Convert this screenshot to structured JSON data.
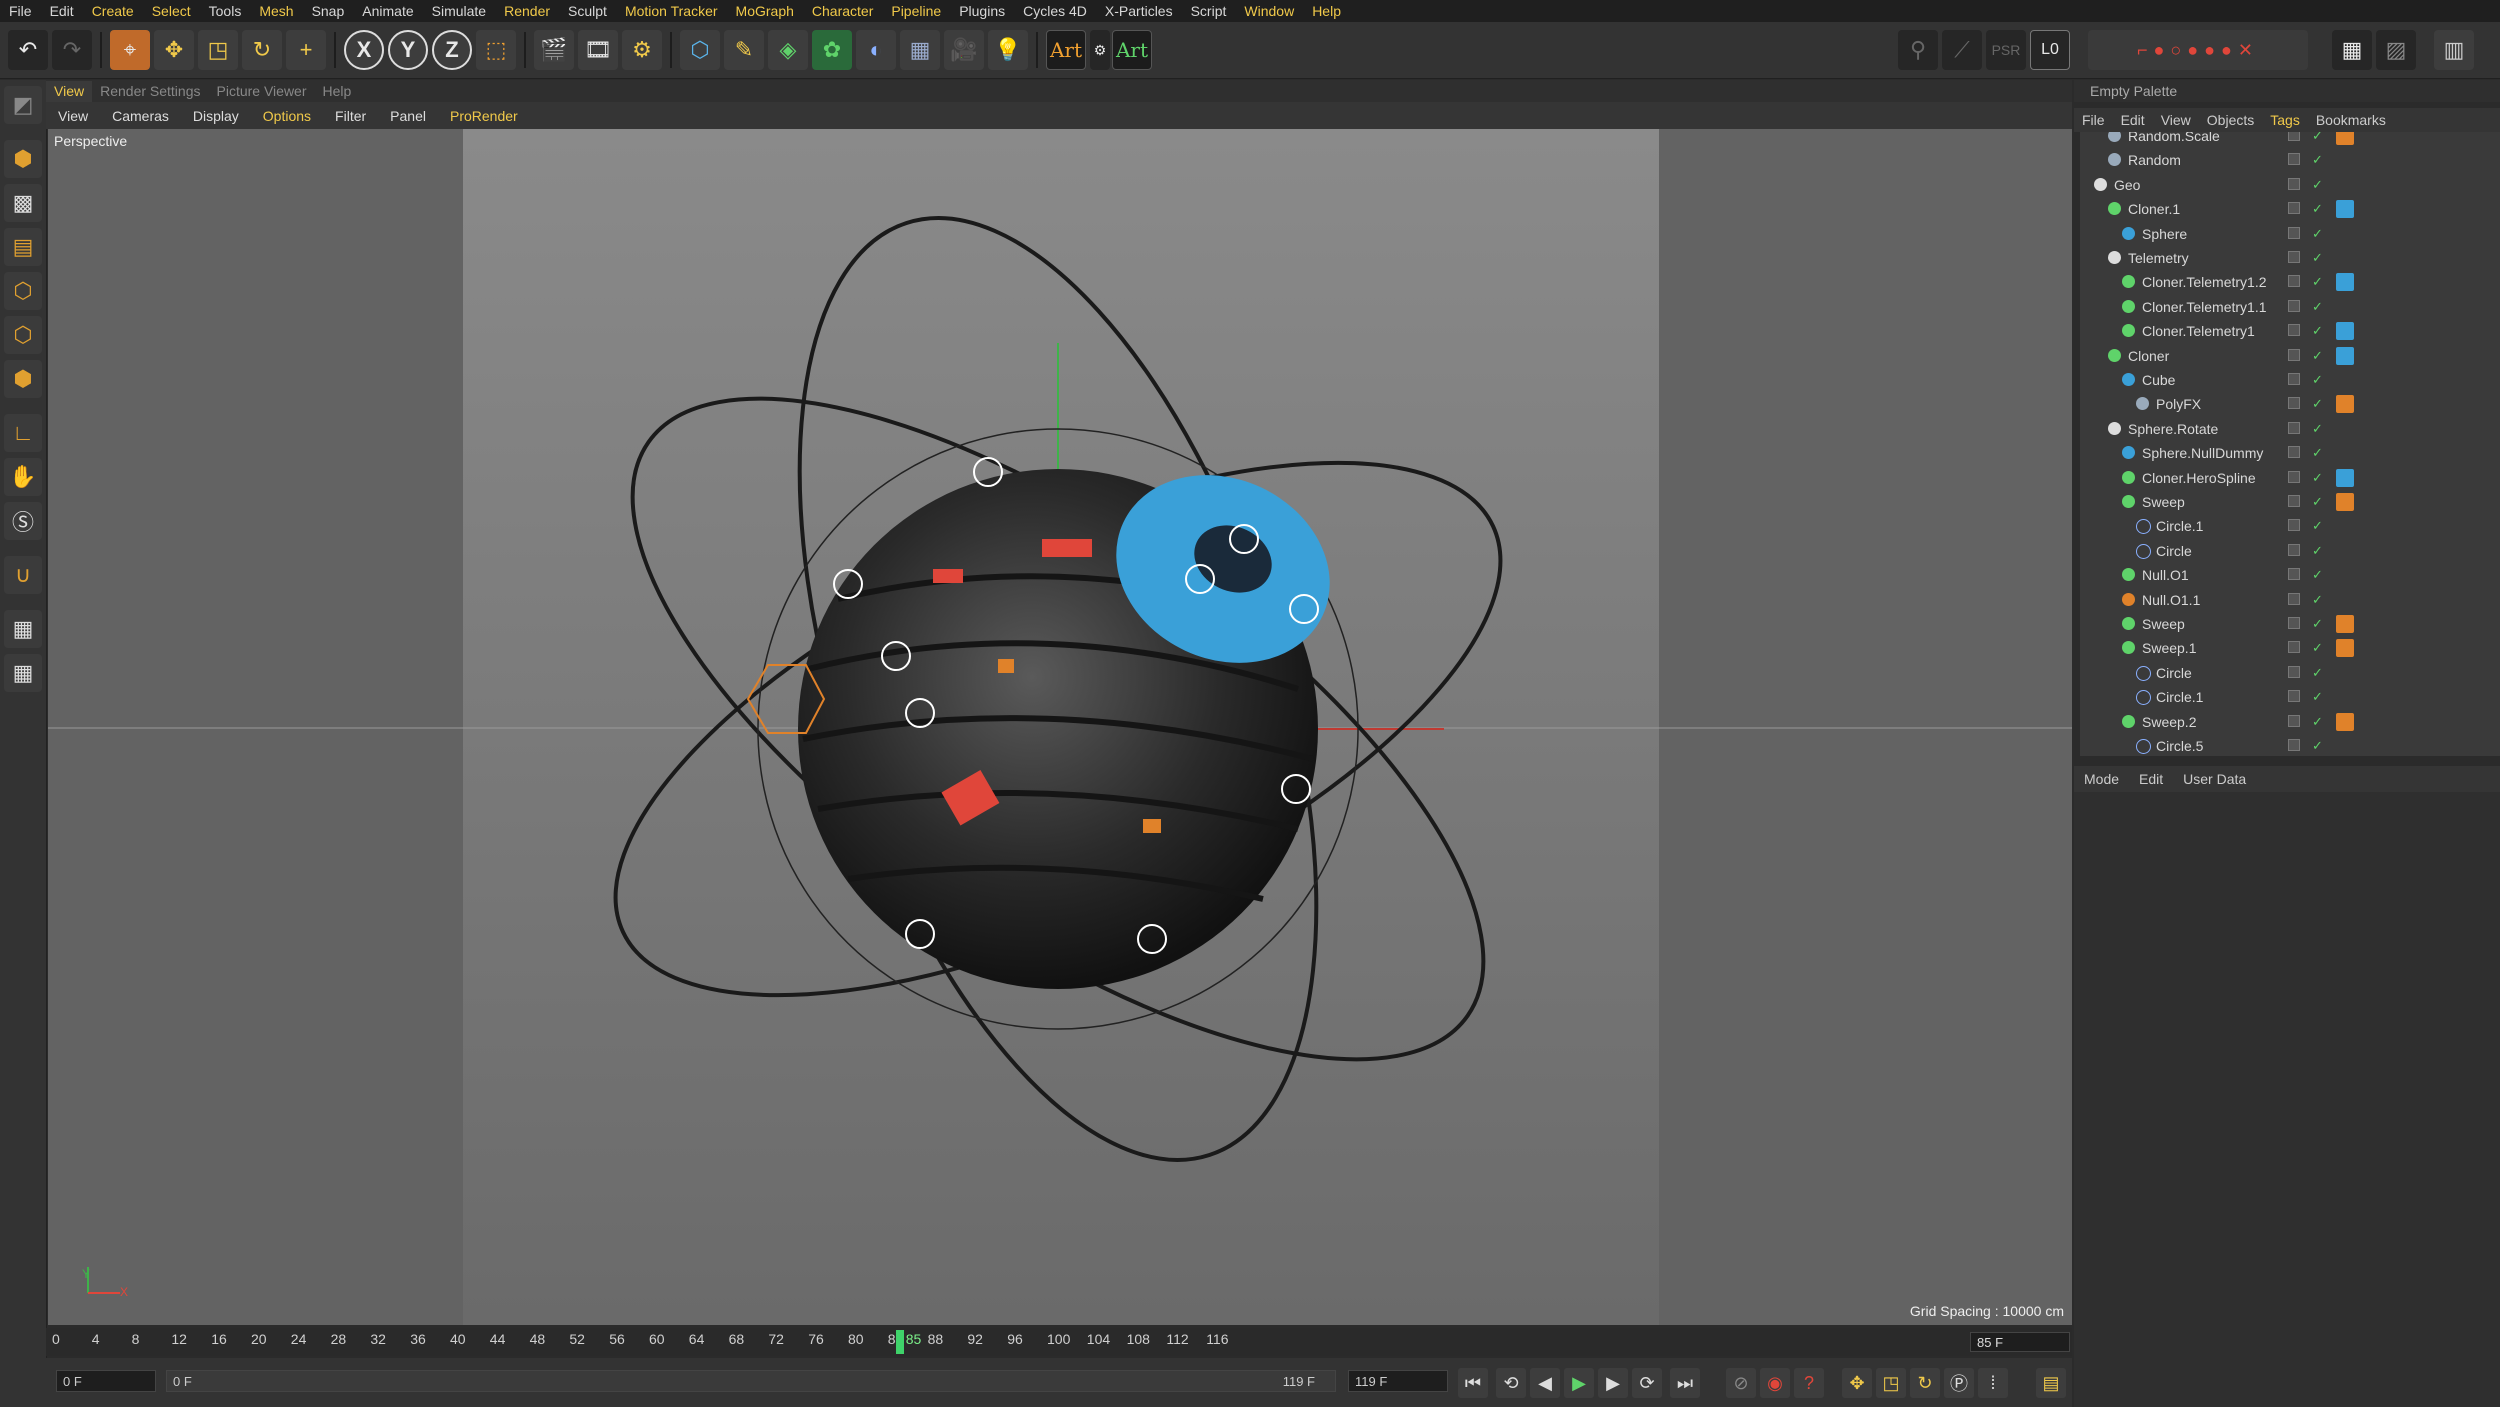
{
  "menubar": [
    "File",
    "Edit",
    "Create",
    "Select",
    "Tools",
    "Mesh",
    "Snap",
    "Animate",
    "Simulate",
    "Render",
    "Sculpt",
    "Motion Tracker",
    "MoGraph",
    "Character",
    "Pipeline",
    "Plugins",
    "Cycles 4D",
    "X-Particles",
    "Script",
    "Window",
    "Help"
  ],
  "menubar_highlighted": [
    "Create",
    "Select",
    "Mesh",
    "Render",
    "Motion Tracker",
    "MoGraph",
    "Character",
    "Pipeline",
    "Window",
    "Help"
  ],
  "toolbar": {
    "axis_x": "X",
    "axis_y": "Y",
    "axis_z": "Z",
    "art_1": "Art",
    "art_2": "Art",
    "layer_label": "L0"
  },
  "viewport_tabs": [
    "View",
    "Render Settings",
    "Picture Viewer",
    "Help"
  ],
  "viewport_menu": [
    "View",
    "Cameras",
    "Display",
    "Options",
    "Filter",
    "Panel",
    "ProRender"
  ],
  "viewport_menu_highlighted": [
    "Options",
    "ProRender"
  ],
  "viewport": {
    "camera_label": "Perspective",
    "grid_spacing": "Grid Spacing : 10000 cm",
    "axis_y": "Y",
    "axis_x": "X",
    "colors": {
      "sphere_cap": "#3aa0d8",
      "accent_red": "#e0463a",
      "accent_orange": "#e0822a"
    }
  },
  "timeline": {
    "ticks": [
      "0",
      "4",
      "8",
      "12",
      "16",
      "20",
      "24",
      "28",
      "32",
      "36",
      "40",
      "44",
      "48",
      "52",
      "56",
      "60",
      "64",
      "68",
      "72",
      "76",
      "80",
      "84",
      "85",
      "88",
      "92",
      "96",
      "100",
      "104",
      "108",
      "112",
      "116"
    ],
    "current_frame": "85",
    "frame_field": "85 F",
    "start_field": "0 F",
    "range_start": "0 F",
    "range_end": "119 F",
    "end_field": "119 F"
  },
  "right_panel": {
    "palette_label": "Empty Palette",
    "object_menu": [
      "File",
      "Edit",
      "View",
      "Objects",
      "Tags",
      "Bookmarks"
    ],
    "object_menu_highlighted": "Tags",
    "objects": [
      {
        "name": "Random.Scale",
        "indent": 1,
        "icon": "effector"
      },
      {
        "name": "Random",
        "indent": 1,
        "icon": "effector"
      },
      {
        "name": "Geo",
        "indent": 0,
        "icon": "null"
      },
      {
        "name": "Cloner.1",
        "indent": 1,
        "icon": "cloner"
      },
      {
        "name": "Sphere",
        "indent": 2,
        "icon": "sphere"
      },
      {
        "name": "Telemetry",
        "indent": 1,
        "icon": "null"
      },
      {
        "name": "Cloner.Telemetry1.2",
        "indent": 2,
        "icon": "cloner"
      },
      {
        "name": "Cloner.Telemetry1.1",
        "indent": 2,
        "icon": "cloner"
      },
      {
        "name": "Cloner.Telemetry1",
        "indent": 2,
        "icon": "cloner"
      },
      {
        "name": "Cloner",
        "indent": 1,
        "icon": "cloner"
      },
      {
        "name": "Cube",
        "indent": 2,
        "icon": "cube"
      },
      {
        "name": "PolyFX",
        "indent": 3,
        "icon": "effector"
      },
      {
        "name": "Sphere.Rotate",
        "indent": 1,
        "icon": "null"
      },
      {
        "name": "Sphere.NullDummy",
        "indent": 2,
        "icon": "sphere"
      },
      {
        "name": "Cloner.HeroSpline",
        "indent": 2,
        "icon": "cloner"
      },
      {
        "name": "Sweep",
        "indent": 2,
        "icon": "sweep"
      },
      {
        "name": "Circle.1",
        "indent": 3,
        "icon": "circle"
      },
      {
        "name": "Circle",
        "indent": 3,
        "icon": "circle"
      },
      {
        "name": "Null.O1",
        "indent": 2,
        "icon": "null-green"
      },
      {
        "name": "Null.O1.1",
        "indent": 2,
        "icon": "null-orange"
      },
      {
        "name": "Sweep",
        "indent": 2,
        "icon": "sweep"
      },
      {
        "name": "Sweep.1",
        "indent": 2,
        "icon": "sweep"
      },
      {
        "name": "Circle",
        "indent": 3,
        "icon": "circle"
      },
      {
        "name": "Circle.1",
        "indent": 3,
        "icon": "circle"
      },
      {
        "name": "Sweep.2",
        "indent": 2,
        "icon": "sweep"
      },
      {
        "name": "Circle.5",
        "indent": 3,
        "icon": "circle"
      }
    ],
    "attr_menu": [
      "Mode",
      "Edit",
      "User Data"
    ]
  }
}
